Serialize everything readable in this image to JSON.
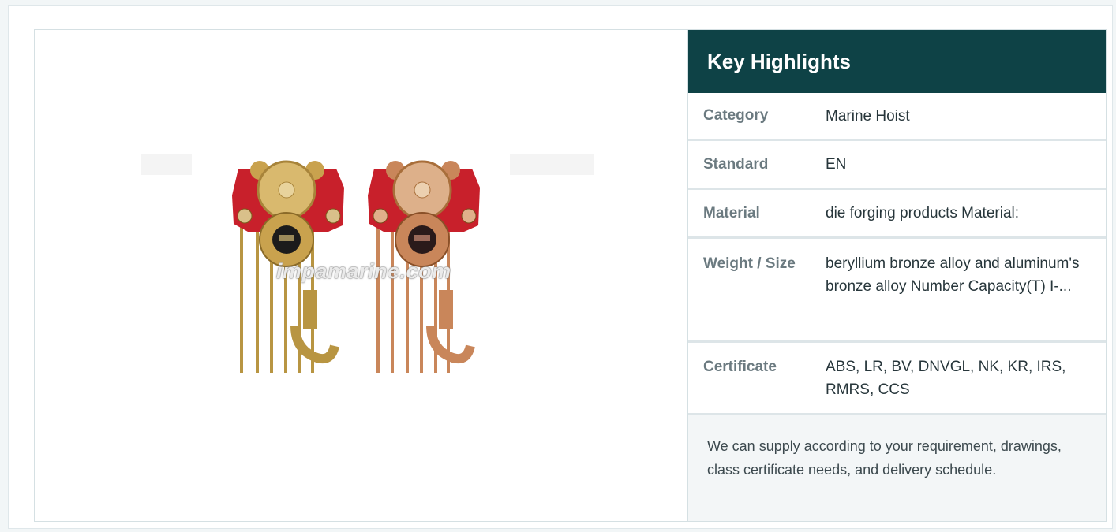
{
  "panel": {
    "title": "Key Highlights",
    "rows": [
      {
        "label": "Category",
        "value": "Marine Hoist"
      },
      {
        "label": "Standard",
        "value": "EN"
      },
      {
        "label": "Material",
        "value": "die forging products Material:"
      },
      {
        "label": "Weight / Size",
        "value": "beryllium bronze alloy and aluminum's bronze alloy Number Capacity(T) I-..."
      },
      {
        "label": "Certificate",
        "value": "ABS, LR, BV, DNVGL, NK, KR, IRS, RMRS, CCS"
      }
    ],
    "note": "We can supply according to your requirement, drawings, class certificate needs, and delivery schedule."
  },
  "image": {
    "watermark": "impamarine.com",
    "subject": "Two spark-proof chain hoist trolleys with red frames and bronze chains"
  },
  "colors": {
    "header_bg": "#0e4246",
    "trolley_red": "#c8202b",
    "bronze": "#c9a24e",
    "copper": "#c9865a"
  }
}
